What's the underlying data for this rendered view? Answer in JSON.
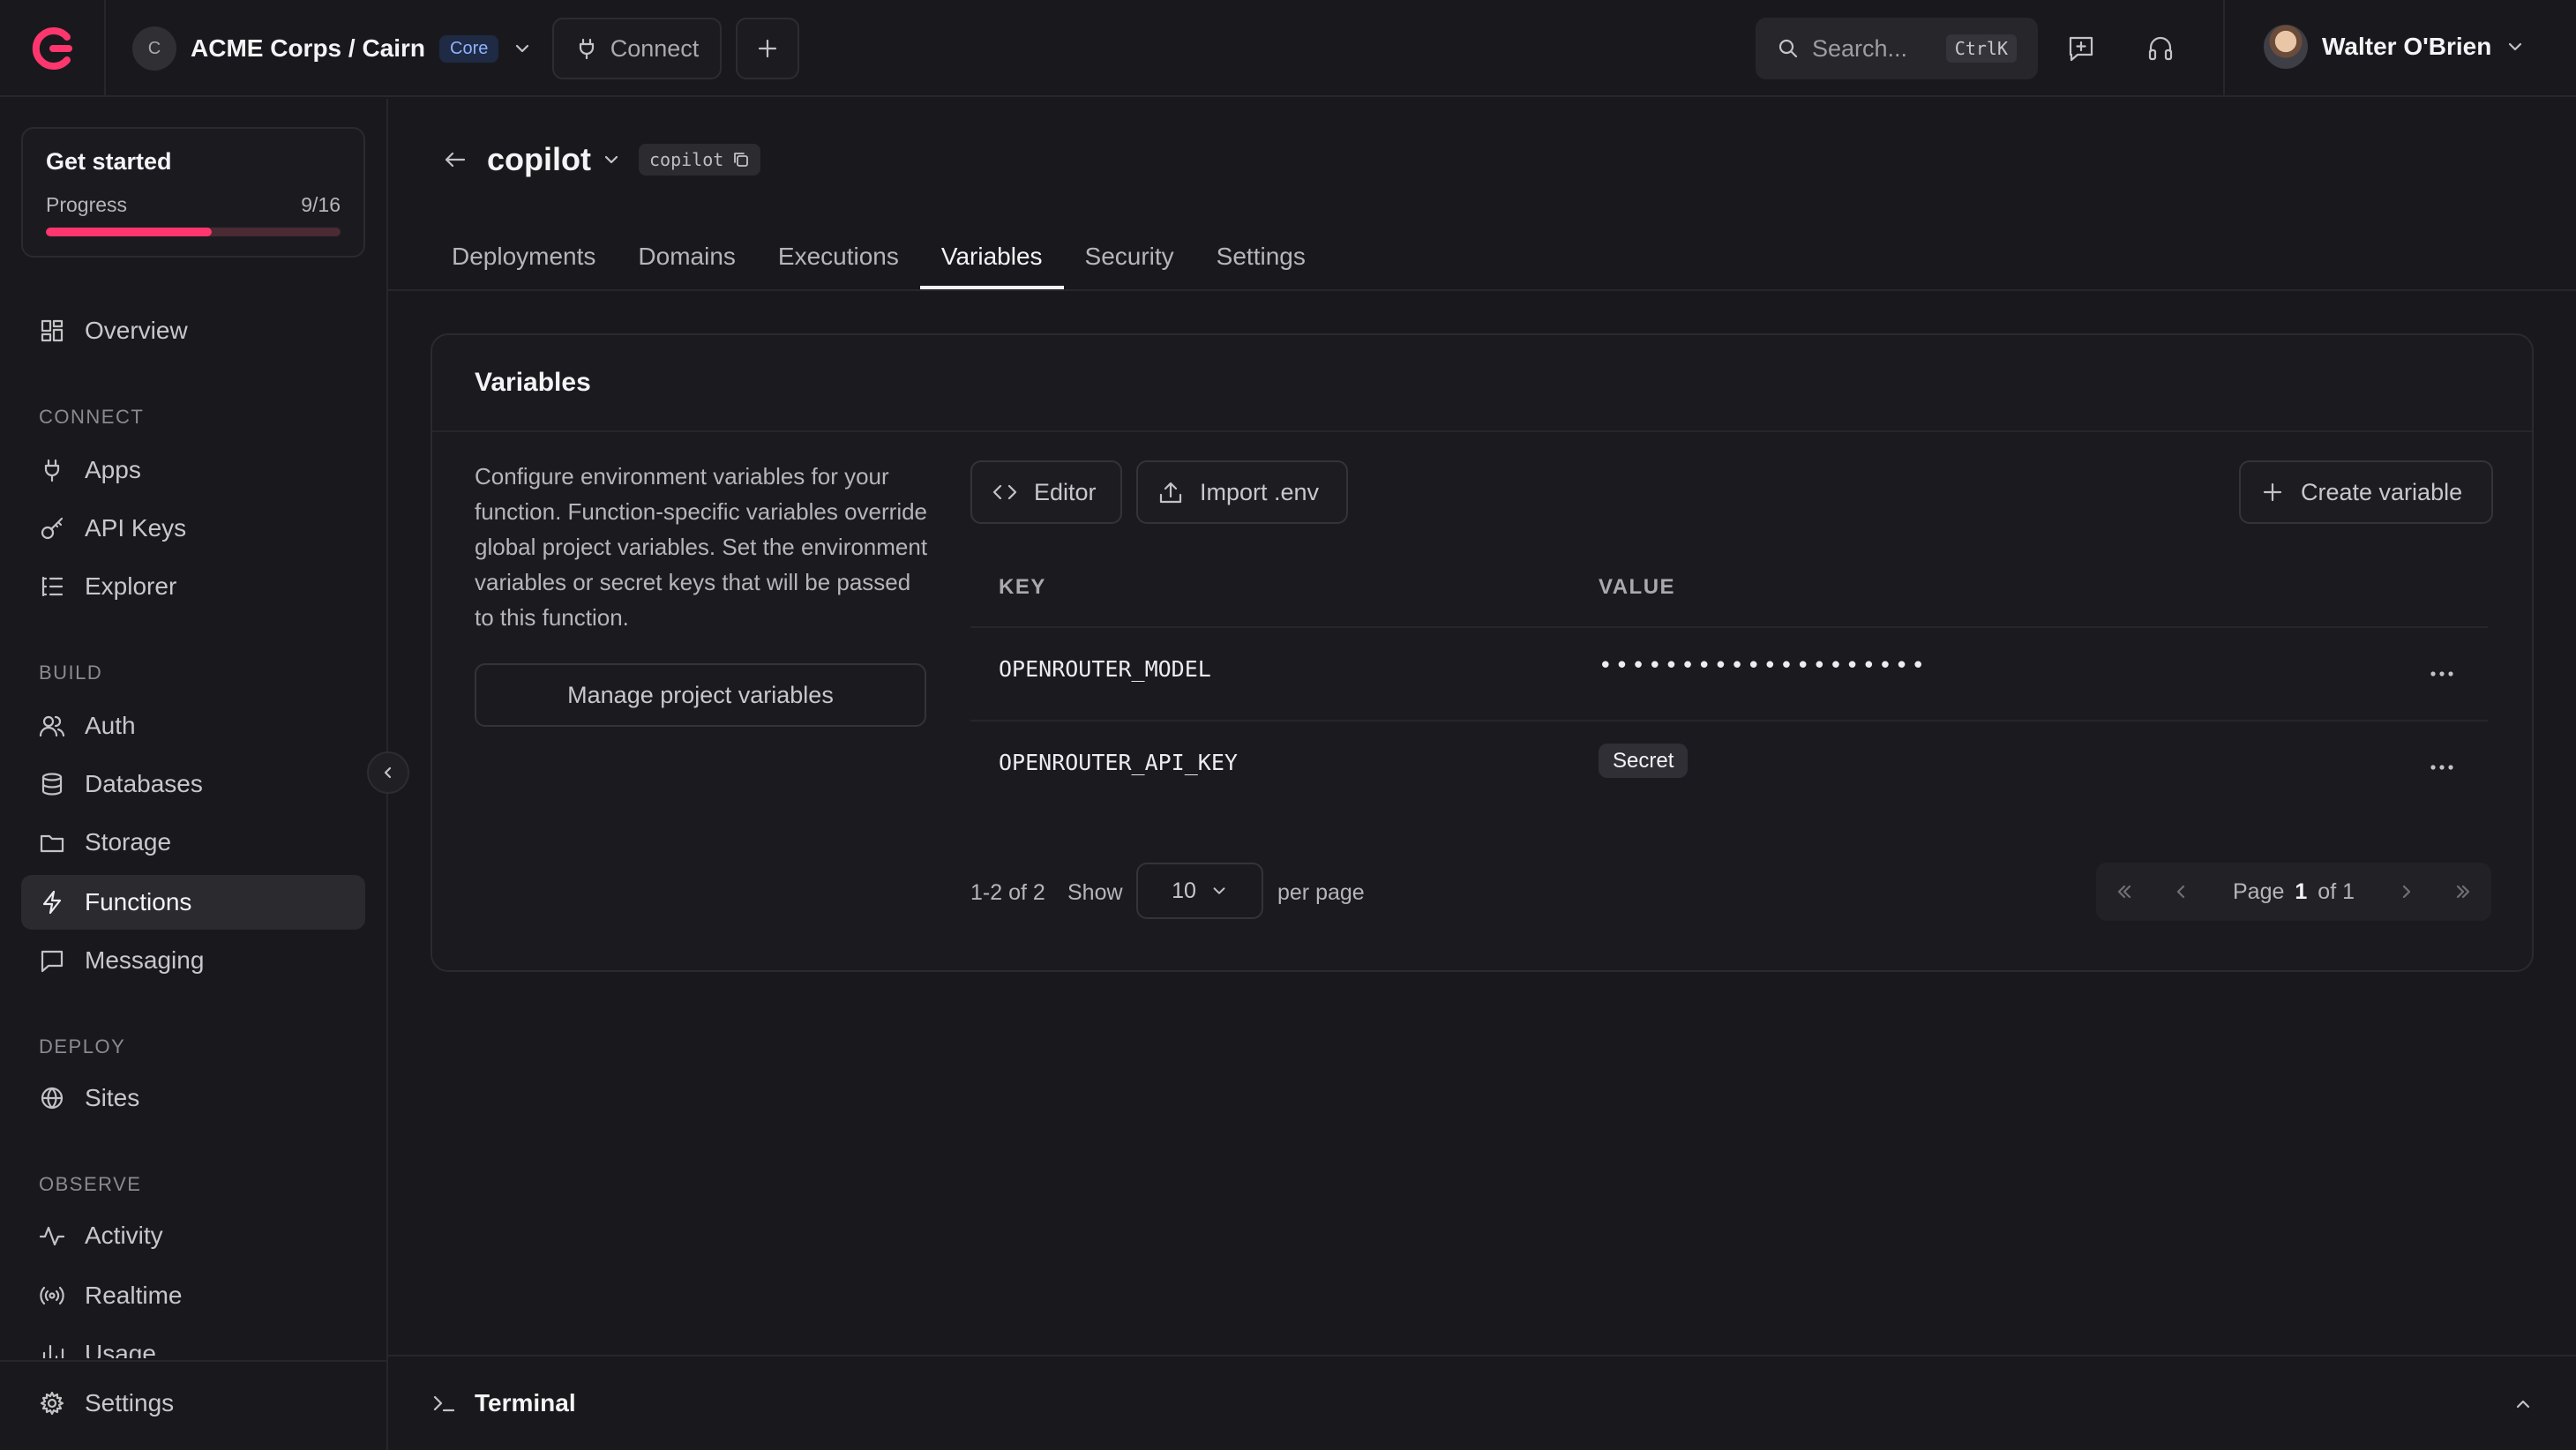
{
  "topbar": {
    "org_initial": "C",
    "org_name": "ACME Corps / Cairn",
    "plan_badge": "Core",
    "connect_label": "Connect",
    "search_placeholder": "Search...",
    "search_shortcut": "CtrlK",
    "user_name": "Walter O'Brien"
  },
  "get_started": {
    "title": "Get started",
    "progress_label": "Progress",
    "progress_text": "9/16",
    "progress_fraction": 0.5625
  },
  "sidebar": {
    "overview": "Overview",
    "sections": {
      "connect": "CONNECT",
      "build": "BUILD",
      "deploy": "DEPLOY",
      "observe": "OBSERVE"
    },
    "items": {
      "apps": "Apps",
      "api_keys": "API Keys",
      "explorer": "Explorer",
      "auth": "Auth",
      "databases": "Databases",
      "storage": "Storage",
      "functions": "Functions",
      "messaging": "Messaging",
      "sites": "Sites",
      "activity": "Activity",
      "realtime": "Realtime",
      "usage": "Usage",
      "settings": "Settings"
    }
  },
  "function": {
    "name": "copilot",
    "id": "copilot"
  },
  "tabs": [
    "Deployments",
    "Domains",
    "Executions",
    "Variables",
    "Security",
    "Settings"
  ],
  "variables": {
    "title": "Variables",
    "description": "Configure environment variables for your function. Function-specific variables override global project variables. Set the environment variables or secret keys that will be passed to this function.",
    "manage_button": "Manage project variables",
    "editor_button": "Editor",
    "import_button": "Import .env",
    "create_button": "Create variable",
    "columns": {
      "key": "KEY",
      "value": "VALUE"
    },
    "rows": [
      {
        "key": "OPENROUTER_MODEL",
        "value": "••••••••••••••••••••"
      },
      {
        "key": "OPENROUTER_API_KEY",
        "value": "Secret"
      }
    ],
    "pagination": {
      "range": "1-2 of 2",
      "show": "Show",
      "per_page_value": "10",
      "per_page": "per page",
      "page_label": "Page",
      "page": "1",
      "of": "of 1"
    }
  },
  "terminal": {
    "label": "Terminal"
  },
  "colors": {
    "accent": "#fd366e",
    "background": "#19191d"
  }
}
